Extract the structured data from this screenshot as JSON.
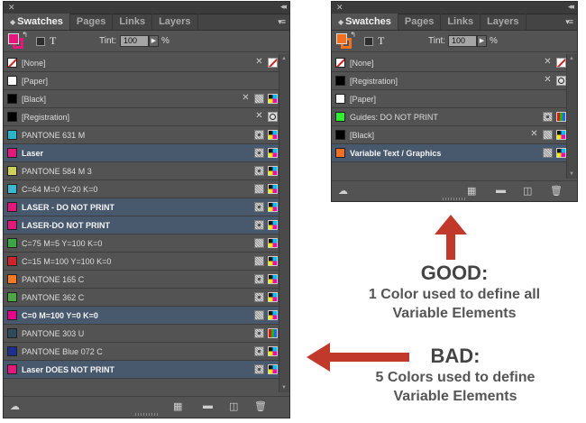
{
  "left_panel": {
    "tabs": [
      "Swatches",
      "Pages",
      "Links",
      "Layers"
    ],
    "tint_label": "Tint:",
    "tint_value": "100",
    "percent": "%",
    "fill_color": "#e6177a",
    "stroke_color": "#e6177a",
    "rows": [
      {
        "label": "[None]",
        "color": "none",
        "bold": false,
        "selected": false,
        "icons": [
          "pencil",
          "nonebox"
        ]
      },
      {
        "label": "[Paper]",
        "color": "#ffffff",
        "bold": false,
        "selected": false,
        "icons": []
      },
      {
        "label": "[Black]",
        "color": "#000000",
        "bold": false,
        "selected": false,
        "icons": [
          "pencil",
          "proc",
          "cmyk"
        ]
      },
      {
        "label": "[Registration]",
        "color": "#000000",
        "bold": false,
        "selected": false,
        "icons": [
          "pencil",
          "reg"
        ]
      },
      {
        "label": "PANTONE 631 M",
        "color": "#29b6cc",
        "bold": false,
        "selected": false,
        "icons": [
          "spot",
          "cmyk"
        ]
      },
      {
        "label": "Laser",
        "color": "#e6177a",
        "bold": true,
        "selected": true,
        "icons": [
          "spot",
          "cmyk"
        ]
      },
      {
        "label": "PANTONE 584 M 3",
        "color": "#cfd05a",
        "bold": false,
        "selected": false,
        "icons": [
          "spot",
          "cmyk"
        ]
      },
      {
        "label": "C=64 M=0 Y=20 K=0",
        "color": "#3ab8cf",
        "bold": false,
        "selected": false,
        "icons": [
          "proc",
          "cmyk"
        ]
      },
      {
        "label": "LASER - DO NOT PRINT",
        "color": "#e6177a",
        "bold": true,
        "selected": true,
        "icons": [
          "spot",
          "cmyk"
        ]
      },
      {
        "label": "LASER-DO NOT PRINT",
        "color": "#e6177a",
        "bold": true,
        "selected": true,
        "icons": [
          "spot",
          "cmyk"
        ]
      },
      {
        "label": "C=75 M=5 Y=100 K=0",
        "color": "#3aa843",
        "bold": false,
        "selected": false,
        "icons": [
          "proc",
          "cmyk"
        ]
      },
      {
        "label": "C=15 M=100 Y=100 K=0",
        "color": "#d2232a",
        "bold": false,
        "selected": false,
        "icons": [
          "proc",
          "cmyk"
        ]
      },
      {
        "label": "PANTONE 165 C",
        "color": "#f47a20",
        "bold": false,
        "selected": false,
        "icons": [
          "spot",
          "cmyk"
        ]
      },
      {
        "label": "PANTONE 362 C",
        "color": "#4ca845",
        "bold": false,
        "selected": false,
        "icons": [
          "spot",
          "cmyk"
        ]
      },
      {
        "label": "C=0 M=100 Y=0 K=0",
        "color": "#ec008c",
        "bold": true,
        "selected": true,
        "icons": [
          "proc",
          "cmyk"
        ]
      },
      {
        "label": "PANTONE 303 U",
        "color": "#2e4a5c",
        "bold": false,
        "selected": false,
        "icons": [
          "spot",
          "rgb"
        ]
      },
      {
        "label": "PANTONE Blue 072 C",
        "color": "#1d2f95",
        "bold": false,
        "selected": false,
        "icons": [
          "spot",
          "cmyk"
        ]
      },
      {
        "label": "Laser DOES NOT PRINT",
        "color": "#e6177a",
        "bold": true,
        "selected": true,
        "icons": [
          "spot",
          "cmyk"
        ]
      }
    ]
  },
  "right_panel": {
    "tabs": [
      "Swatches",
      "Pages",
      "Links",
      "Layers"
    ],
    "tint_label": "Tint:",
    "tint_value": "100",
    "percent": "%",
    "fill_color": "#f37021",
    "stroke_color": "#f37021",
    "rows": [
      {
        "label": "[None]",
        "color": "none",
        "bold": false,
        "selected": false,
        "icons": [
          "pencil",
          "nonebox"
        ]
      },
      {
        "label": "[Registration]",
        "color": "#000000",
        "bold": false,
        "selected": false,
        "icons": [
          "pencil",
          "reg"
        ]
      },
      {
        "label": "[Paper]",
        "color": "#ffffff",
        "bold": false,
        "selected": false,
        "icons": []
      },
      {
        "label": "Guides: DO NOT PRINT",
        "color": "#2ef02e",
        "bold": false,
        "selected": false,
        "icons": [
          "spot",
          "rgb"
        ]
      },
      {
        "label": "[Black]",
        "color": "#000000",
        "bold": false,
        "selected": false,
        "icons": [
          "pencil",
          "proc",
          "cmyk"
        ]
      },
      {
        "label": "Variable Text / Graphics",
        "color": "#f37021",
        "bold": true,
        "selected": true,
        "icons": [
          "proc",
          "cmyk"
        ]
      }
    ]
  },
  "good_callout": {
    "heading": "GOOD:",
    "line1": "1 Color used to define all",
    "line2": "Variable Elements"
  },
  "bad_callout": {
    "heading": "BAD:",
    "line1": "5 Colors used to define",
    "line2": "Variable Elements"
  },
  "arrow_color": "#c0392b"
}
